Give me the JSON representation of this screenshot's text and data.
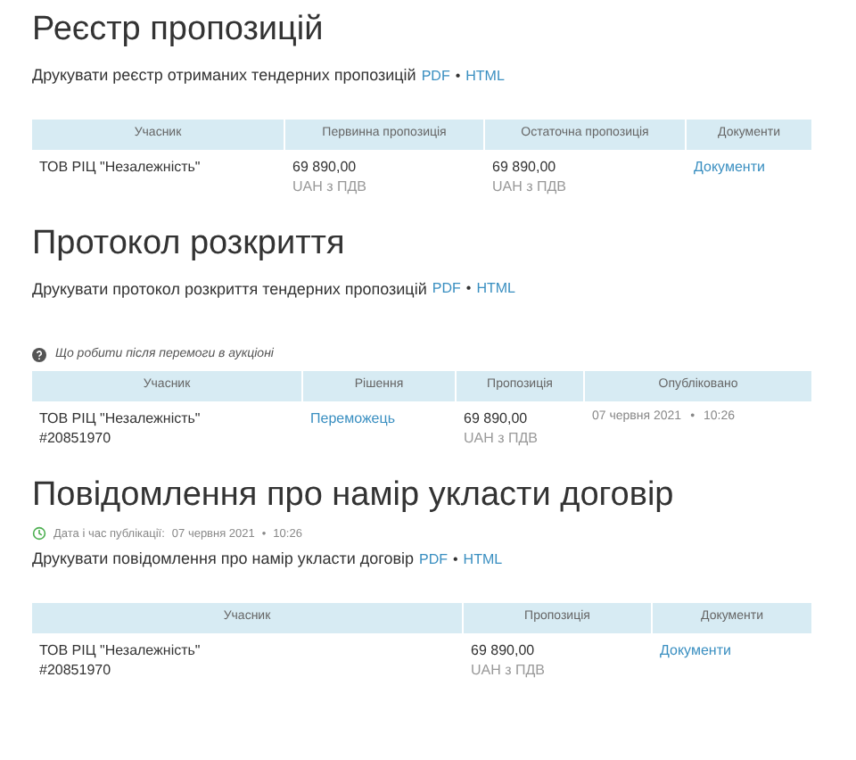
{
  "sections": [
    {
      "title": "Реєстр пропозицій",
      "print": {
        "text": "Друкувати реєстр отриманих тендерних пропозицій",
        "links": [
          "PDF",
          "HTML"
        ],
        "separator": "•"
      },
      "table": {
        "columns": [
          "Учасник",
          "Первинна пропозиція",
          "Остаточна пропозиція",
          "Документи"
        ],
        "rows": [
          [
            {
              "kind": "text",
              "text": "ТОВ РІЦ \"Незалежність\""
            },
            {
              "kind": "amount",
              "value": "69 890,00",
              "currency": "UAH з ПДВ"
            },
            {
              "kind": "amount",
              "value": "69 890,00",
              "currency": "UAH з ПДВ"
            },
            {
              "kind": "link",
              "text": "Документи"
            }
          ]
        ]
      }
    },
    {
      "title": "Протокол розкриття",
      "print": {
        "text": "Друкувати протокол розкриття тендерних пропозицій",
        "links": [
          "PDF",
          "HTML"
        ],
        "separator": "•"
      },
      "help": "Що робити після перемоги в аукціоні",
      "table": {
        "columns": [
          "Учасник",
          "Рішення",
          "Пропозиція",
          "Опубліковано"
        ],
        "rows": [
          [
            {
              "kind": "participant",
              "name": "ТОВ РІЦ \"Незалежність\"",
              "code": "#20851970"
            },
            {
              "kind": "link",
              "text": "Переможець"
            },
            {
              "kind": "amount",
              "value": "69 890,00",
              "currency": "UAH з ПДВ"
            },
            {
              "kind": "date",
              "date": "07 червня 2021",
              "separator": "•",
              "time": "10:26"
            }
          ]
        ]
      }
    },
    {
      "title": "Повідомлення про намір укласти договір",
      "published": {
        "label": "Дата і час публікації:",
        "date": "07 червня 2021",
        "separator": "•",
        "time": "10:26"
      },
      "print": {
        "text": "Друкувати повідомлення про намір укласти договір",
        "links": [
          "PDF",
          "HTML"
        ],
        "separator": "•"
      },
      "table": {
        "columns": [
          "Учасник",
          "Пропозиція",
          "Документи"
        ],
        "rows": [
          [
            {
              "kind": "participant",
              "name": "ТОВ РІЦ \"Незалежність\"",
              "code": "#20851970"
            },
            {
              "kind": "amount",
              "value": "69 890,00",
              "currency": "UAH з ПДВ"
            },
            {
              "kind": "link",
              "text": "Документи"
            }
          ]
        ]
      }
    }
  ]
}
